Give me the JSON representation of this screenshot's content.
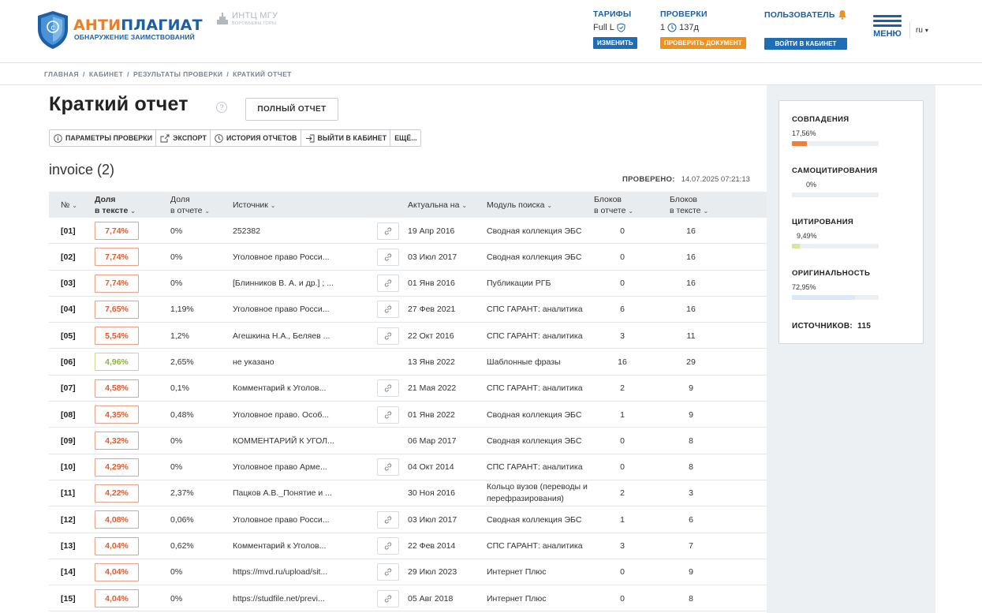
{
  "header": {
    "brand_a": "АНТИ",
    "brand_b": "ПЛАГИАТ",
    "brand_sub": "ОБНАРУЖЕНИЕ ЗАИМСТВОВАНИЙ",
    "partner_title": "ИНТЦ МГУ",
    "partner_sub": "ВОРОБЬЕВЫ ГОРЫ",
    "tariffs": {
      "title": "ТАРИФЫ",
      "value": "Full L",
      "button": "ИЗМЕНИТЬ"
    },
    "checks": {
      "title": "ПРОВЕРКИ",
      "count": "1",
      "days": "137д",
      "button": "ПРОВЕРИТЬ ДОКУМЕНТ"
    },
    "user": {
      "title": "ПОЛЬЗОВАТЕЛЬ",
      "button": "ВОЙТИ В КАБИНЕТ"
    },
    "menu_label": "МЕНЮ",
    "lang": "ru"
  },
  "breadcrumb": [
    "ГЛАВНАЯ",
    "КАБИНЕТ",
    "РЕЗУЛЬТАТЫ ПРОВЕРКИ",
    "КРАТКИЙ ОТЧЕТ"
  ],
  "page": {
    "title": "Краткий отчет",
    "help": "?",
    "full_report_button": "ПОЛНЫЙ ОТЧЕТ",
    "toolbar": {
      "params": "ПАРАМЕТРЫ ПРОВЕРКИ",
      "export": "ЭКСПОРТ",
      "history": "ИСТОРИЯ ОТЧЕТОВ",
      "exit": "ВЫЙТИ В КАБИНЕТ",
      "more": "ЕЩЁ..."
    },
    "document_name": "invoice (2)",
    "checked_label": "ПРОВЕРЕНО:",
    "checked_value": "14.07.2025 07:21:13"
  },
  "table": {
    "headers": {
      "num": "№",
      "share_text_1": "Доля",
      "share_text_2": "в тексте",
      "share_report_1": "Доля",
      "share_report_2": "в отчете",
      "source": "Источник",
      "actual": "Актуальна на",
      "module": "Модуль поиска",
      "blocks_report_1": "Блоков",
      "blocks_report_2": "в отчете",
      "blocks_text_1": "Блоков",
      "blocks_text_2": "в тексте"
    },
    "rows": [
      {
        "num": "[01]",
        "pct": "7,74%",
        "share": "0%",
        "source": "252382",
        "link": true,
        "date": "19 Апр 2016",
        "module": "Сводная коллекция ЭБС",
        "br": "0",
        "bt": "16"
      },
      {
        "num": "[02]",
        "pct": "7,74%",
        "share": "0%",
        "source": "Уголовное право Росси...",
        "link": true,
        "date": "03 Июл 2017",
        "module": "Сводная коллекция ЭБС",
        "br": "0",
        "bt": "16"
      },
      {
        "num": "[03]",
        "pct": "7,74%",
        "share": "0%",
        "source": "[Блинников В. А. и др.] ; ...",
        "link": true,
        "date": "01 Янв 2016",
        "module": "Публикации РГБ",
        "br": "0",
        "bt": "16"
      },
      {
        "num": "[04]",
        "pct": "7,65%",
        "share": "1,19%",
        "source": "Уголовное право Росси...",
        "link": true,
        "date": "27 Фев 2021",
        "module": "СПС ГАРАНТ: аналитика",
        "br": "6",
        "bt": "16"
      },
      {
        "num": "[05]",
        "pct": "5,54%",
        "share": "1,2%",
        "source": "Агешкина Н.А., Беляев ...",
        "link": true,
        "date": "22 Окт 2016",
        "module": "СПС ГАРАНТ: аналитика",
        "br": "3",
        "bt": "11"
      },
      {
        "num": "[06]",
        "pct": "4,96%",
        "share": "2,65%",
        "source": "не указано",
        "link": false,
        "date": "13 Янв 2022",
        "module": "Шаблонные фразы",
        "br": "16",
        "bt": "29",
        "green": true
      },
      {
        "num": "[07]",
        "pct": "4,58%",
        "share": "0,1%",
        "source": "Комментарий к Уголов...",
        "link": true,
        "date": "21 Мая 2022",
        "module": "СПС ГАРАНТ: аналитика",
        "br": "2",
        "bt": "9"
      },
      {
        "num": "[08]",
        "pct": "4,35%",
        "share": "0,48%",
        "source": "Уголовное право. Особ...",
        "link": true,
        "date": "01 Янв 2022",
        "module": "Сводная коллекция ЭБС",
        "br": "1",
        "bt": "9"
      },
      {
        "num": "[09]",
        "pct": "4,32%",
        "share": "0%",
        "source": "КОММЕНТАРИЙ К УГОЛ...",
        "link": false,
        "date": "06 Мар 2017",
        "module": "Сводная коллекция ЭБС",
        "br": "0",
        "bt": "8"
      },
      {
        "num": "[10]",
        "pct": "4,29%",
        "share": "0%",
        "source": "Уголовное право Арме...",
        "link": true,
        "date": "04 Окт 2014",
        "module": "СПС ГАРАНТ: аналитика",
        "br": "0",
        "bt": "8"
      },
      {
        "num": "[11]",
        "pct": "4,22%",
        "share": "2,37%",
        "source": "Пацков А.В._Понятие и ...",
        "link": false,
        "date": "30 Ноя 2016",
        "module": "Кольцо вузов (переводы и перефразирования)",
        "br": "2",
        "bt": "3",
        "two": true
      },
      {
        "num": "[12]",
        "pct": "4,08%",
        "share": "0,06%",
        "source": "Уголовное право Росси...",
        "link": true,
        "date": "03 Июл 2017",
        "module": "Сводная коллекция ЭБС",
        "br": "1",
        "bt": "6"
      },
      {
        "num": "[13]",
        "pct": "4,04%",
        "share": "0,62%",
        "source": "Комментарий к Уголов...",
        "link": true,
        "date": "22 Фев 2014",
        "module": "СПС ГАРАНТ: аналитика",
        "br": "3",
        "bt": "7"
      },
      {
        "num": "[14]",
        "pct": "4,04%",
        "share": "0%",
        "source": "https://mvd.ru/upload/sit...",
        "link": true,
        "date": "29 Июл 2023",
        "module": "Интернет Плюс",
        "br": "0",
        "bt": "9"
      },
      {
        "num": "[15]",
        "pct": "4,04%",
        "share": "0%",
        "source": "https://studfile.net/previ...",
        "link": true,
        "date": "05 Авг 2018",
        "module": "Интернет Плюс",
        "br": "0",
        "bt": "8"
      }
    ]
  },
  "stats": {
    "matches": {
      "label": "СОВПАДЕНИЯ",
      "value": "17,56%",
      "fraction": 0.1756,
      "color": "#f07d3a"
    },
    "self_citation": {
      "label": "САМОЦИТИРОВАНИЯ",
      "value": "0%",
      "fraction": 0,
      "color": "#7bb3e0"
    },
    "citation": {
      "label": "ЦИТИРОВАНИЯ",
      "value": "9,49%",
      "fraction": 0.0949,
      "color": "#d6e6a0"
    },
    "originality": {
      "label": "ОРИГИНАЛЬНОСТЬ",
      "value": "72,95%",
      "fraction": 0.7295,
      "color": "#dbe9f7"
    },
    "sources_label": "ИСТОЧНИКОВ:",
    "sources_value": "115"
  }
}
